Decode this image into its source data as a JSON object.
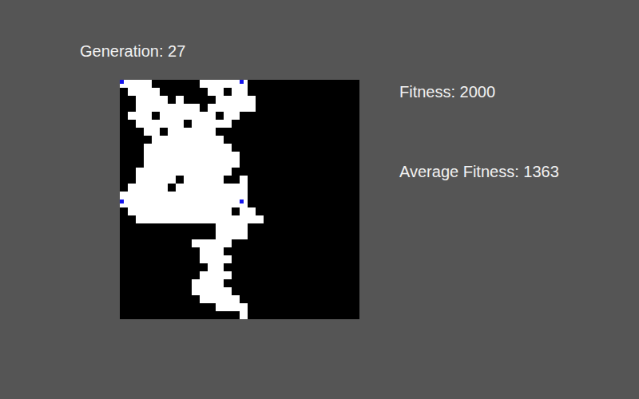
{
  "generation": {
    "label": "Generation: 27"
  },
  "fitness": {
    "label": "Fitness: 2000"
  },
  "average_fitness": {
    "label": "Average Fitness: 1363"
  },
  "canvas": {
    "white": [
      [
        1,
        2,
        3,
        10,
        11,
        12,
        13,
        14
      ],
      [
        1,
        2,
        3,
        4,
        11,
        12,
        14,
        15
      ],
      [
        2,
        3,
        4,
        5,
        7,
        12,
        13,
        14,
        15,
        16
      ],
      [
        2,
        3,
        4,
        5,
        6,
        7,
        8,
        9,
        11,
        12,
        13,
        14,
        15,
        16
      ],
      [
        1,
        2,
        3,
        5,
        6,
        7,
        8,
        9,
        10,
        11,
        13,
        14
      ],
      [
        2,
        3,
        4,
        5,
        6,
        7,
        9,
        10,
        11,
        12,
        13
      ],
      [
        3,
        4,
        6,
        7,
        8,
        9,
        10,
        11
      ],
      [
        4,
        5,
        6,
        7,
        8,
        9,
        10,
        11,
        12
      ],
      [
        3,
        4,
        5,
        6,
        7,
        8,
        9,
        10,
        11,
        12,
        13
      ],
      [
        3,
        4,
        5,
        6,
        7,
        8,
        9,
        10,
        11,
        12,
        13,
        14
      ],
      [
        3,
        4,
        5,
        6,
        7,
        8,
        9,
        10,
        11,
        12,
        13,
        14
      ],
      [
        2,
        3,
        4,
        5,
        6,
        7,
        8,
        9,
        10,
        11,
        12,
        13
      ],
      [
        2,
        3,
        4,
        5,
        6,
        8,
        9,
        10,
        11,
        12,
        15
      ],
      [
        1,
        2,
        3,
        4,
        5,
        7,
        8,
        9,
        10,
        11,
        12,
        13,
        14,
        15
      ],
      [
        0,
        1,
        2,
        3,
        4,
        5,
        6,
        7,
        8,
        9,
        10,
        11,
        12,
        13,
        14,
        15
      ],
      [
        1,
        2,
        3,
        4,
        5,
        6,
        7,
        8,
        9,
        10,
        11,
        12,
        13,
        14
      ],
      [
        1,
        2,
        3,
        4,
        5,
        6,
        7,
        8,
        9,
        10,
        11,
        12,
        13,
        15,
        16
      ],
      [
        2,
        3,
        4,
        5,
        6,
        7,
        8,
        9,
        10,
        11,
        12,
        13,
        14,
        15,
        16,
        17
      ],
      [
        12,
        13,
        14,
        15
      ],
      [
        12,
        13,
        14,
        15
      ],
      [
        9,
        10,
        11,
        12,
        13
      ],
      [
        10,
        11,
        12
      ],
      [
        10,
        11,
        12,
        13
      ],
      [
        11,
        12
      ],
      [
        10,
        11,
        12,
        13
      ],
      [
        9,
        10,
        11,
        12
      ],
      [
        9,
        10,
        11,
        12,
        13
      ],
      [
        10,
        11,
        12,
        13,
        14
      ],
      [
        12,
        13,
        14,
        15
      ],
      [
        15
      ]
    ],
    "blue": [
      [
        0,
        0
      ],
      [
        0,
        15
      ],
      [
        15,
        0
      ],
      [
        15,
        15
      ]
    ]
  }
}
